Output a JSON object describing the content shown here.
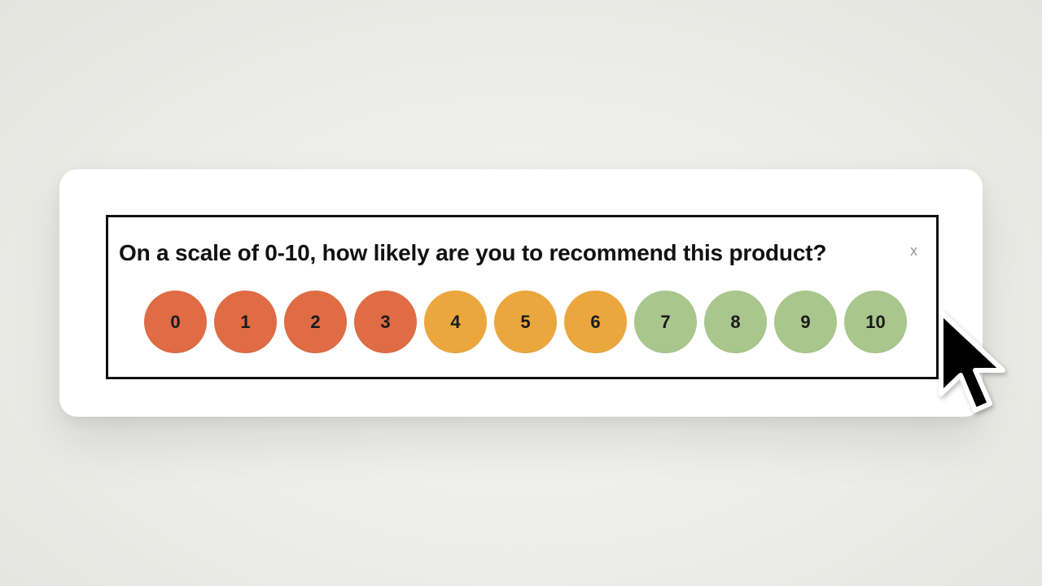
{
  "survey": {
    "question": "On a scale of 0-10, how likely are you to recommend this product?",
    "close_label": "x",
    "options": [
      {
        "label": "0",
        "color": "#df6c44"
      },
      {
        "label": "1",
        "color": "#df6c44"
      },
      {
        "label": "2",
        "color": "#df6c44"
      },
      {
        "label": "3",
        "color": "#df6c44"
      },
      {
        "label": "4",
        "color": "#eba73d"
      },
      {
        "label": "5",
        "color": "#eba73d"
      },
      {
        "label": "6",
        "color": "#eba73d"
      },
      {
        "label": "7",
        "color": "#a9c78c"
      },
      {
        "label": "8",
        "color": "#a9c78c"
      },
      {
        "label": "9",
        "color": "#a9c78c"
      },
      {
        "label": "10",
        "color": "#a9c78c"
      }
    ]
  },
  "cursor": {
    "icon": "arrow-cursor-icon"
  }
}
